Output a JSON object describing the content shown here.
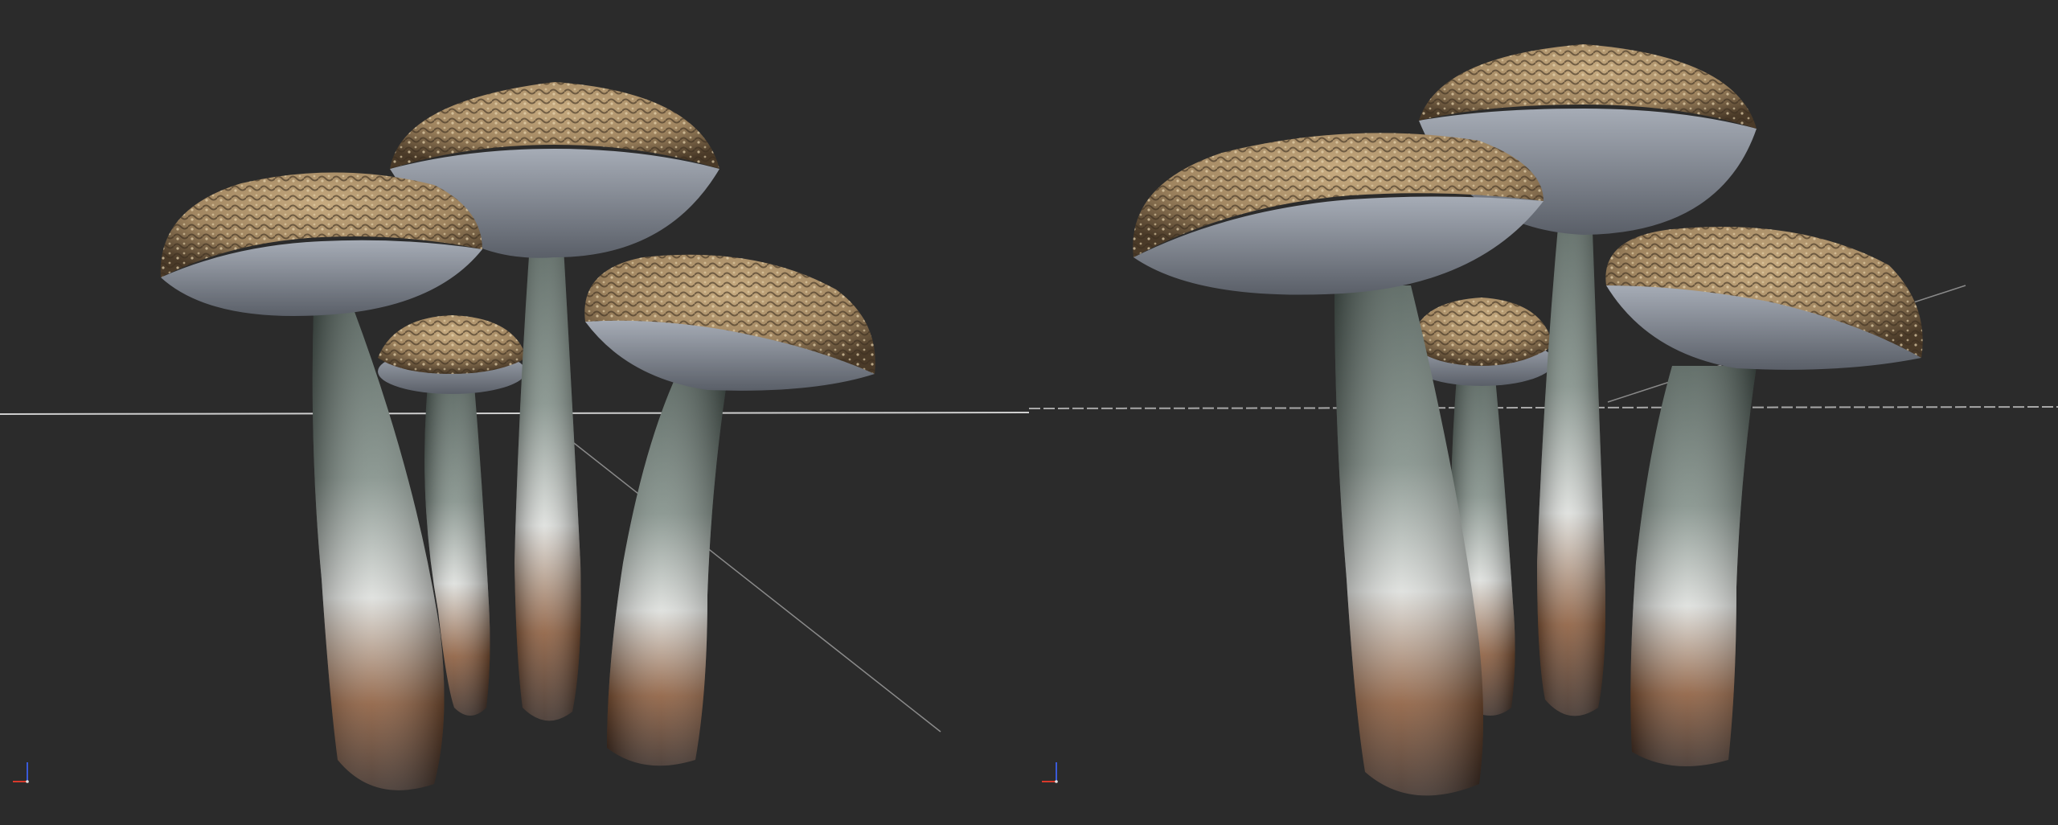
{
  "app": {
    "view_count": 2
  },
  "viewports": [
    {
      "id": "left",
      "view_mode": "perspective",
      "axis_gizmo": {
        "x_color": "#d93a2b",
        "y_color": "#3a5ad9",
        "z_color": "#e0e0e0"
      }
    },
    {
      "id": "right",
      "view_mode": "perspective",
      "axis_gizmo": {
        "x_color": "#d93a2b",
        "y_color": "#3a5ad9",
        "z_color": "#e0e0e0"
      }
    }
  ],
  "colors": {
    "background": "#2b2b2b",
    "horizon_line": "#cfcfcf",
    "cap_top": "#b69a72",
    "cap_dark": "#4a3a28",
    "gills": "#8f95a1",
    "stem_top": "#5f6e68",
    "stem_mid": "#d9dbd8",
    "stem_base": "#6e3f25"
  }
}
